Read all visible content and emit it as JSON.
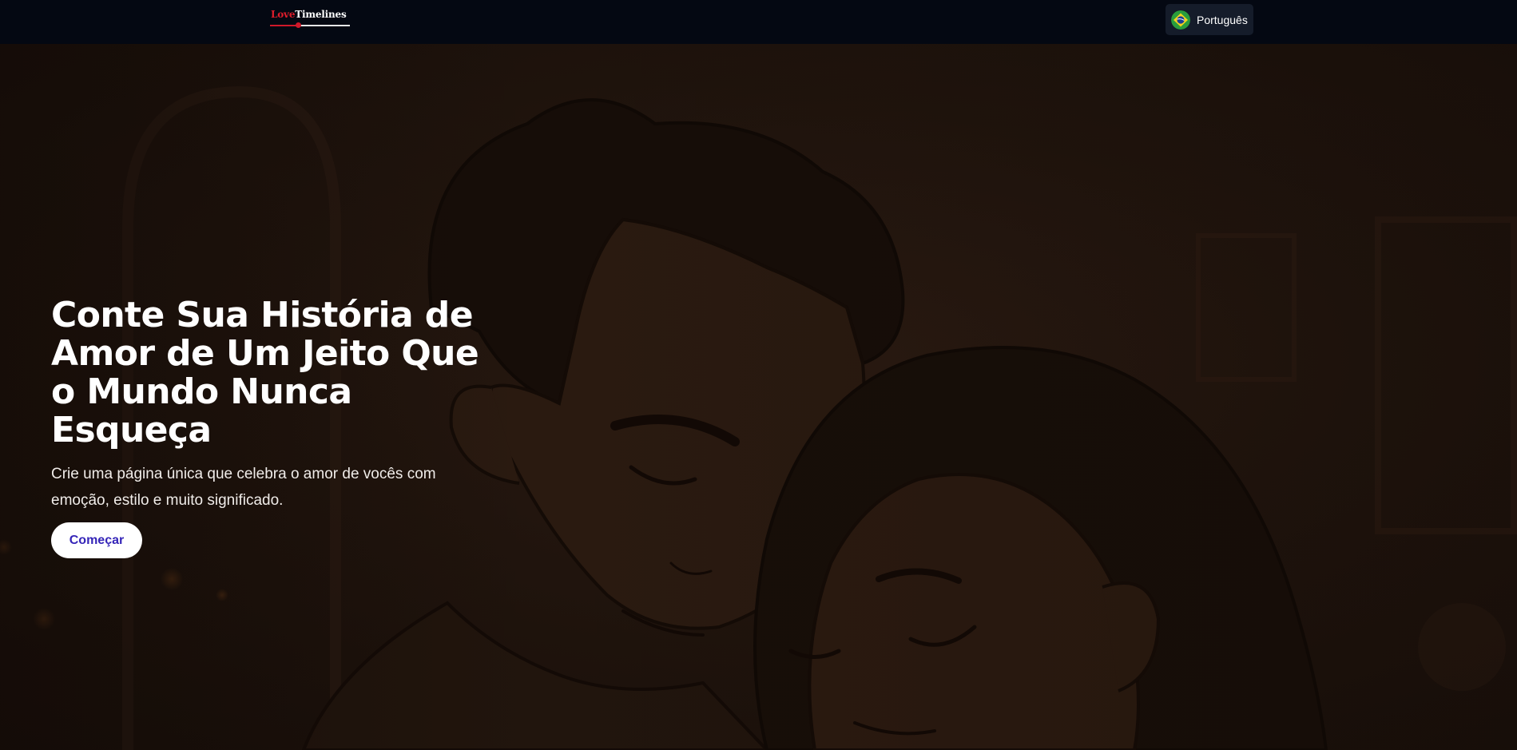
{
  "header": {
    "logo": {
      "part1": "Love",
      "part2": "Timelines"
    },
    "language": {
      "label": "Português",
      "flag_icon": "brazil-flag-icon"
    }
  },
  "hero": {
    "title": "Conte Sua História de Amor de Um Jeito Que o Mundo Nunca Esqueça",
    "subtitle": "Crie uma página única que celebra o amor de vocês com emoção, estilo e muito significado.",
    "cta_label": "Começar"
  },
  "colors": {
    "header_bg": "#040812",
    "hero_bg": "#1b110c",
    "logo_red": "#e01d2b",
    "cta_text": "#3525b8",
    "cta_bg": "#ffffff",
    "language_button_bg": "#151c2a"
  }
}
